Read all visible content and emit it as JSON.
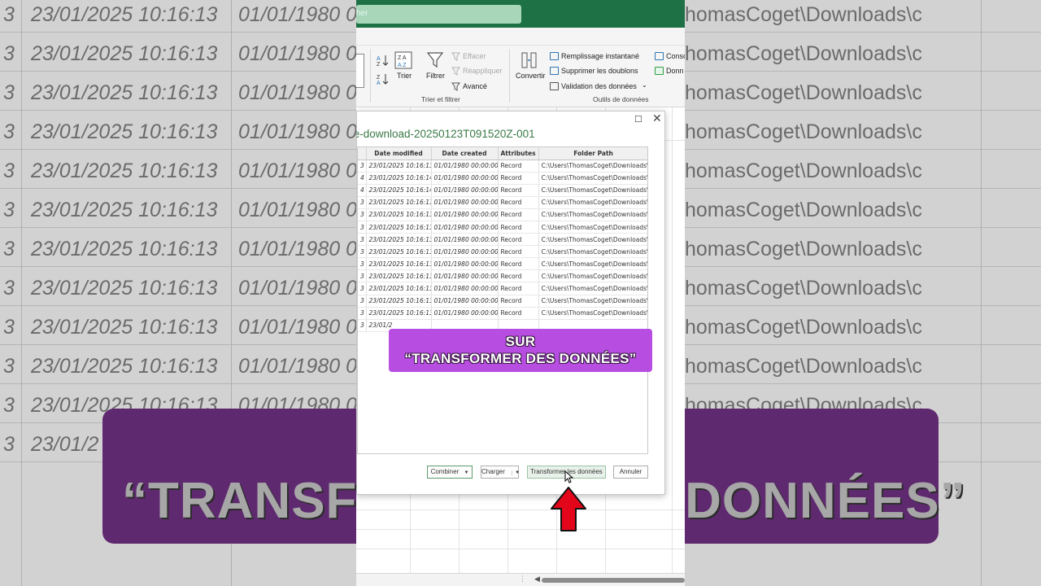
{
  "background": {
    "rows": [
      {
        "a": "3",
        "b": "23/01/2025 10:16:13",
        "c": "01/01/1980 0",
        "d": "homasCoget\\Downloads\\c"
      },
      {
        "a": "3",
        "b": "23/01/2025 10:16:13",
        "c": "01/01/1980 0",
        "d": "homasCoget\\Downloads\\c"
      },
      {
        "a": "3",
        "b": "23/01/2025 10:16:13",
        "c": "01/01/1980 0",
        "d": "homasCoget\\Downloads\\c"
      },
      {
        "a": "3",
        "b": "23/01/2025 10:16:13",
        "c": "01/01/1980 0",
        "d": "homasCoget\\Downloads\\c"
      },
      {
        "a": "3",
        "b": "23/01/2025 10:16:13",
        "c": "01/01/1980 0",
        "d": "homasCoget\\Downloads\\c"
      },
      {
        "a": "3",
        "b": "23/01/2025 10:16:13",
        "c": "01/01/1980 0",
        "d": "homasCoget\\Downloads\\c"
      },
      {
        "a": "3",
        "b": "23/01/2025 10:16:13",
        "c": "01/01/1980 0",
        "d": "homasCoget\\Downloads\\c"
      },
      {
        "a": "3",
        "b": "23/01/2025 10:16:13",
        "c": "01/01/1980 0",
        "d": "homasCoget\\Downloads\\c"
      },
      {
        "a": "3",
        "b": "23/01/2025 10:16:13",
        "c": "01/01/1980 0",
        "d": "homasCoget\\Downloads\\c"
      },
      {
        "a": "3",
        "b": "23/01/2025 10:16:13",
        "c": "01/01/1980 0",
        "d": "homasCoget\\Downloads\\c"
      },
      {
        "a": "3",
        "b": "23/01/2025 10:16:13",
        "c": "01/01/1980 0",
        "d": "homasCoget\\Downloads\\c"
      },
      {
        "a": "3",
        "b": "23/01/2",
        "c": "",
        "d": ""
      }
    ],
    "banner_text": "“TRANSFORMER DES DONNÉES”"
  },
  "excel": {
    "search_placeholder": "her",
    "ribbon": {
      "trier": "Trier",
      "filtrer": "Filtrer",
      "effacer": "Effacer",
      "reappliquer": "Réappliquer",
      "avance": "Avancé",
      "group_trier_filtrer": "Trier et filtrer",
      "convertir": "Convertir",
      "remplissage": "Remplissage instantané",
      "supprimer_doublons": "Supprimer les doublons",
      "validation": "Validation des données",
      "group_outils": "Outils de données",
      "conso": "Conso",
      "donn": "Donn"
    },
    "dialog": {
      "title": "ive-download-20250123T091520Z-001",
      "columns": [
        "",
        "Date modified",
        "Date created",
        "Attributes",
        "Folder Path"
      ],
      "rows": [
        [
          "3",
          "23/01/2025 10:16:13",
          "01/01/1980 00:00:00",
          "Record",
          "C:\\Users\\ThomasCoget\\Downloads\\c"
        ],
        [
          "4",
          "23/01/2025 10:16:14",
          "01/01/1980 00:00:00",
          "Record",
          "C:\\Users\\ThomasCoget\\Downloads\\c"
        ],
        [
          "4",
          "23/01/2025 10:16:14",
          "01/01/1980 00:00:00",
          "Record",
          "C:\\Users\\ThomasCoget\\Downloads\\c"
        ],
        [
          "3",
          "23/01/2025 10:16:13",
          "01/01/1980 00:00:00",
          "Record",
          "C:\\Users\\ThomasCoget\\Downloads\\c"
        ],
        [
          "3",
          "23/01/2025 10:16:13",
          "01/01/1980 00:00:00",
          "Record",
          "C:\\Users\\ThomasCoget\\Downloads\\c"
        ],
        [
          "3",
          "23/01/2025 10:16:13",
          "01/01/1980 00:00:00",
          "Record",
          "C:\\Users\\ThomasCoget\\Downloads\\c"
        ],
        [
          "3",
          "23/01/2025 10:16:13",
          "01/01/1980 00:00:00",
          "Record",
          "C:\\Users\\ThomasCoget\\Downloads\\c"
        ],
        [
          "3",
          "23/01/2025 10:16:13",
          "01/01/1980 00:00:00",
          "Record",
          "C:\\Users\\ThomasCoget\\Downloads\\c"
        ],
        [
          "3",
          "23/01/2025 10:16:13",
          "01/01/1980 00:00:00",
          "Record",
          "C:\\Users\\ThomasCoget\\Downloads\\c"
        ],
        [
          "3",
          "23/01/2025 10:16:13",
          "01/01/1980 00:00:00",
          "Record",
          "C:\\Users\\ThomasCoget\\Downloads\\c"
        ],
        [
          "3",
          "23/01/2025 10:16:13",
          "01/01/1980 00:00:00",
          "Record",
          "C:\\Users\\ThomasCoget\\Downloads\\c"
        ],
        [
          "3",
          "23/01/2025 10:16:13",
          "01/01/1980 00:00:00",
          "Record",
          "C:\\Users\\ThomasCoget\\Downloads\\c"
        ],
        [
          "3",
          "23/01/2025 10:16:13",
          "01/01/1980 00:00:00",
          "Record",
          "C:\\Users\\ThomasCoget\\Downloads\\c"
        ],
        [
          "3",
          "23/01/2",
          "",
          "",
          ""
        ]
      ],
      "buttons": {
        "combiner": "Combiner",
        "charger": "Charger",
        "transformer": "Transformer les données",
        "annuler": "Annuler"
      }
    }
  },
  "callout": {
    "line1": "SUR",
    "line2": "“TRANSFORMER DES DONNÉES”"
  },
  "colors": {
    "excel_green": "#1e7145",
    "callout_purple": "#b84de2",
    "arrow_red": "#e3061a"
  }
}
